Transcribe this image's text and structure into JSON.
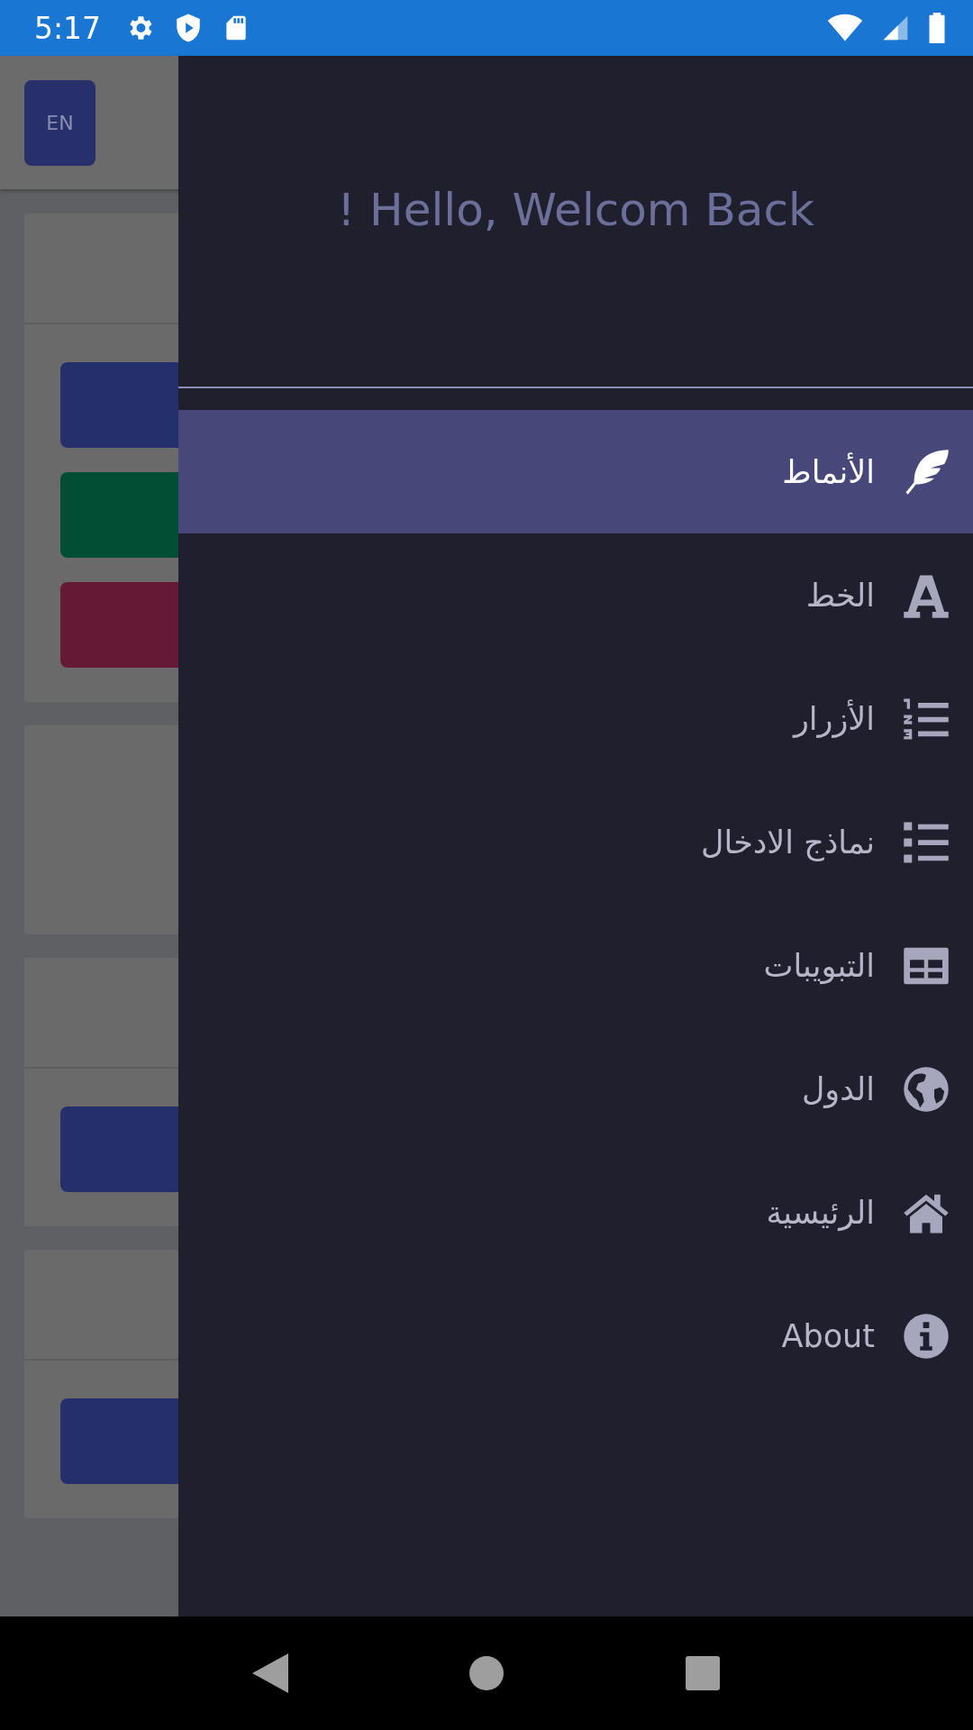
{
  "status_bar": {
    "time": "5:17"
  },
  "header": {
    "language_button": "EN"
  },
  "cards": [
    {
      "divided": true,
      "buttons": [
        {
          "color": "#242f6b"
        },
        {
          "color": "#024e35"
        },
        {
          "color": "#661934"
        }
      ]
    },
    {
      "divided": false
    },
    {
      "divided": true,
      "buttons": [
        {
          "color": "#242f6b"
        }
      ]
    },
    {
      "divided": true,
      "buttons": [
        {
          "color": "#242f6b"
        }
      ]
    }
  ],
  "drawer": {
    "greeting": "! Hello, Welcom Back",
    "items": [
      {
        "label": "الأنماط",
        "kind": "feather",
        "selected": true
      },
      {
        "label": "الخط",
        "kind": "font",
        "selected": false
      },
      {
        "label": "الأزرار",
        "kind": "numbered",
        "selected": false
      },
      {
        "label": "نماذج الادخال",
        "kind": "list",
        "selected": false
      },
      {
        "label": "التبويبات",
        "kind": "table",
        "selected": false
      },
      {
        "label": "الدول",
        "kind": "globe",
        "selected": false
      },
      {
        "label": "الرئيسية",
        "kind": "home",
        "selected": false
      },
      {
        "label": "About",
        "kind": "info",
        "selected": false
      }
    ]
  }
}
